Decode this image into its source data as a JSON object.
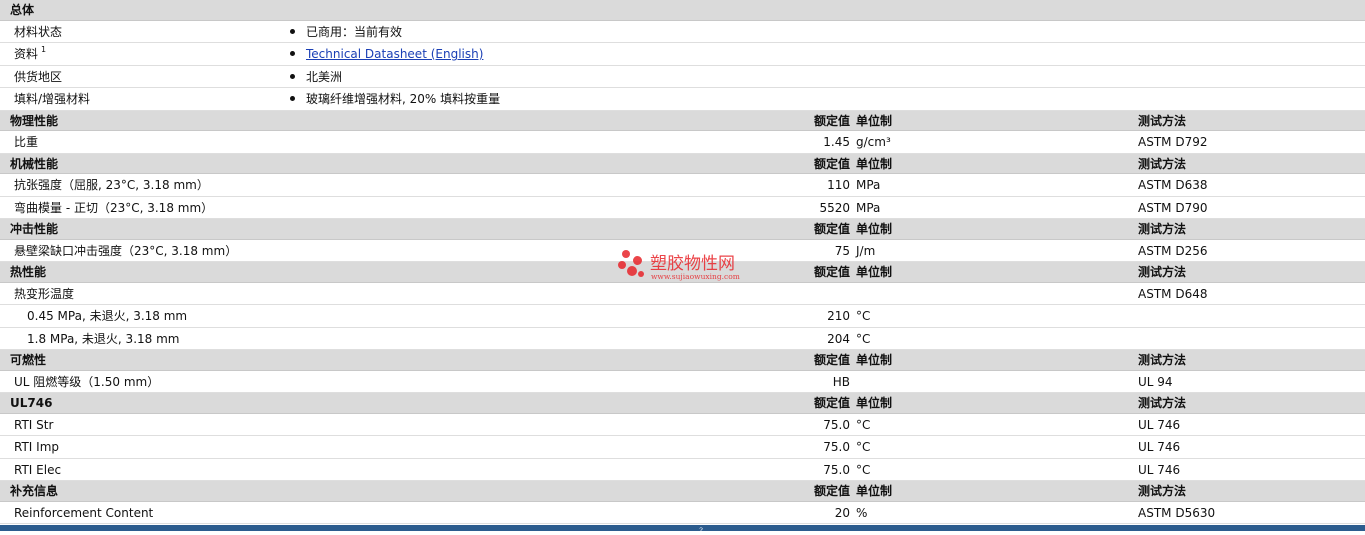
{
  "general": {
    "title": "总体",
    "rows": [
      {
        "label": "材料状态",
        "value": "已商用：当前有效"
      },
      {
        "label": "资料",
        "sup": "1",
        "value": "Technical Datasheet (English)"
      },
      {
        "label": "供货地区",
        "value": "北美洲"
      },
      {
        "label": "填料/增强材料",
        "value": "玻璃纤维增强材料, 20% 填料按重量"
      }
    ]
  },
  "headers": {
    "value": "额定值",
    "unit": "单位制",
    "test": "测试方法"
  },
  "sections": {
    "physical": {
      "title": "物理性能",
      "rows": [
        {
          "label": "比重",
          "value": "1.45",
          "unit": "g/cm³",
          "test": "ASTM D792"
        }
      ]
    },
    "mechanical": {
      "title": "机械性能",
      "rows": [
        {
          "label": "抗张强度（屈服, 23°C, 3.18 mm）",
          "value": "110",
          "unit": "MPa",
          "test": "ASTM D638"
        },
        {
          "label": "弯曲模量 - 正切（23°C, 3.18 mm）",
          "value": "5520",
          "unit": "MPa",
          "test": "ASTM D790"
        }
      ]
    },
    "impact": {
      "title": "冲击性能",
      "rows": [
        {
          "label": "悬壁梁缺口冲击强度（23°C, 3.18 mm）",
          "value": "75",
          "unit": "J/m",
          "test": "ASTM D256"
        }
      ]
    },
    "thermal": {
      "title": "热性能",
      "rows": [
        {
          "label": "热变形温度",
          "value": "",
          "unit": "",
          "test": "ASTM D648"
        },
        {
          "label": "0.45 MPa, 未退火, 3.18 mm",
          "value": "210",
          "unit": "°C",
          "test": ""
        },
        {
          "label": "1.8 MPa, 未退火, 3.18 mm",
          "value": "204",
          "unit": "°C",
          "test": ""
        }
      ]
    },
    "flammability": {
      "title": "可燃性",
      "rows": [
        {
          "label": "UL 阻燃等级（1.50 mm）",
          "value": "HB",
          "unit": "",
          "test": "UL 94"
        }
      ]
    },
    "ul746": {
      "title": "UL746",
      "rows": [
        {
          "label": "RTI Str",
          "value": "75.0",
          "unit": "°C",
          "test": "UL 746"
        },
        {
          "label": "RTI Imp",
          "value": "75.0",
          "unit": "°C",
          "test": "UL 746"
        },
        {
          "label": "RTI Elec",
          "value": "75.0",
          "unit": "°C",
          "test": "UL 746"
        }
      ]
    },
    "supplemental": {
      "title": "补充信息",
      "rows": [
        {
          "label": "Reinforcement Content",
          "value": "20",
          "unit": "%",
          "test": "ASTM D5630"
        }
      ]
    }
  },
  "watermark": {
    "name": "塑胶物性网",
    "url": "www.sujiaowuxing.com",
    "color": "#e8252a"
  },
  "colors": {
    "section_bg": "#dadada",
    "link": "#1a3fb5",
    "bottom_bar": "#2c5c8e"
  }
}
